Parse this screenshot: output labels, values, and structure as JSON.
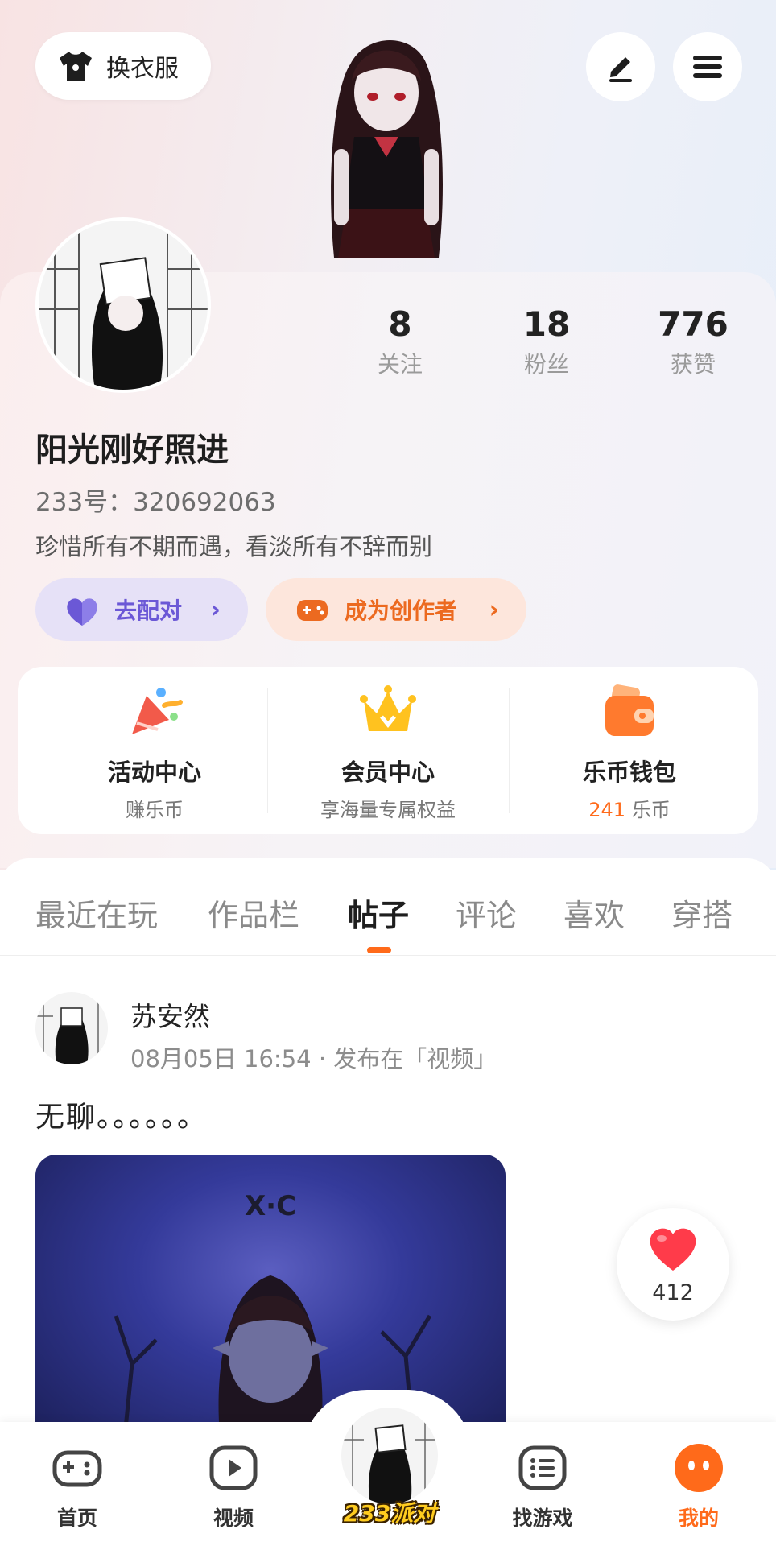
{
  "header": {
    "outfit_button_label": "换衣服",
    "outfit_icon": "shirt-icon",
    "edit_icon": "pen-icon",
    "menu_icon": "menu-icon"
  },
  "profile": {
    "stats": [
      {
        "value": "8",
        "label": "关注"
      },
      {
        "value": "18",
        "label": "粉丝"
      },
      {
        "value": "776",
        "label": "获赞"
      }
    ],
    "username": "阳光刚好照进",
    "user_id": "233号：320692063",
    "bio": "珍惜所有不期而遇，看淡所有不辞而别",
    "pair_button_label": "去配对",
    "creator_button_label": "成为创作者"
  },
  "services": [
    {
      "title": "活动中心",
      "subtitle": "赚乐币",
      "icon": "party-icon"
    },
    {
      "title": "会员中心",
      "subtitle": "享海量专属权益",
      "icon": "crown-icon"
    },
    {
      "title": "乐币钱包",
      "amount": "241",
      "unit": "乐币",
      "icon": "wallet-icon"
    }
  ],
  "tabs": [
    "最近在玩",
    "作品栏",
    "帖子",
    "评论",
    "喜欢",
    "穿搭"
  ],
  "active_tab": "帖子",
  "post": {
    "author": "苏安然",
    "meta": "08月05日 16:54 · 发布在「视频」",
    "text": "无聊。。。。。。",
    "media_watermark": "X·C",
    "likes": "412"
  },
  "bottom_nav": [
    {
      "label": "首页",
      "icon": "gamepad-icon"
    },
    {
      "label": "视频",
      "icon": "play-icon"
    },
    {
      "label": "233派对",
      "icon": "avatar-icon"
    },
    {
      "label": "找游戏",
      "icon": "list-icon"
    },
    {
      "label": "我的",
      "icon": "face-icon"
    }
  ],
  "colors": {
    "accent": "#ff6a1a",
    "pair_purple": "#6b58d6",
    "creator_orange": "#ec6a20",
    "like_red": "#ff3b4a"
  }
}
